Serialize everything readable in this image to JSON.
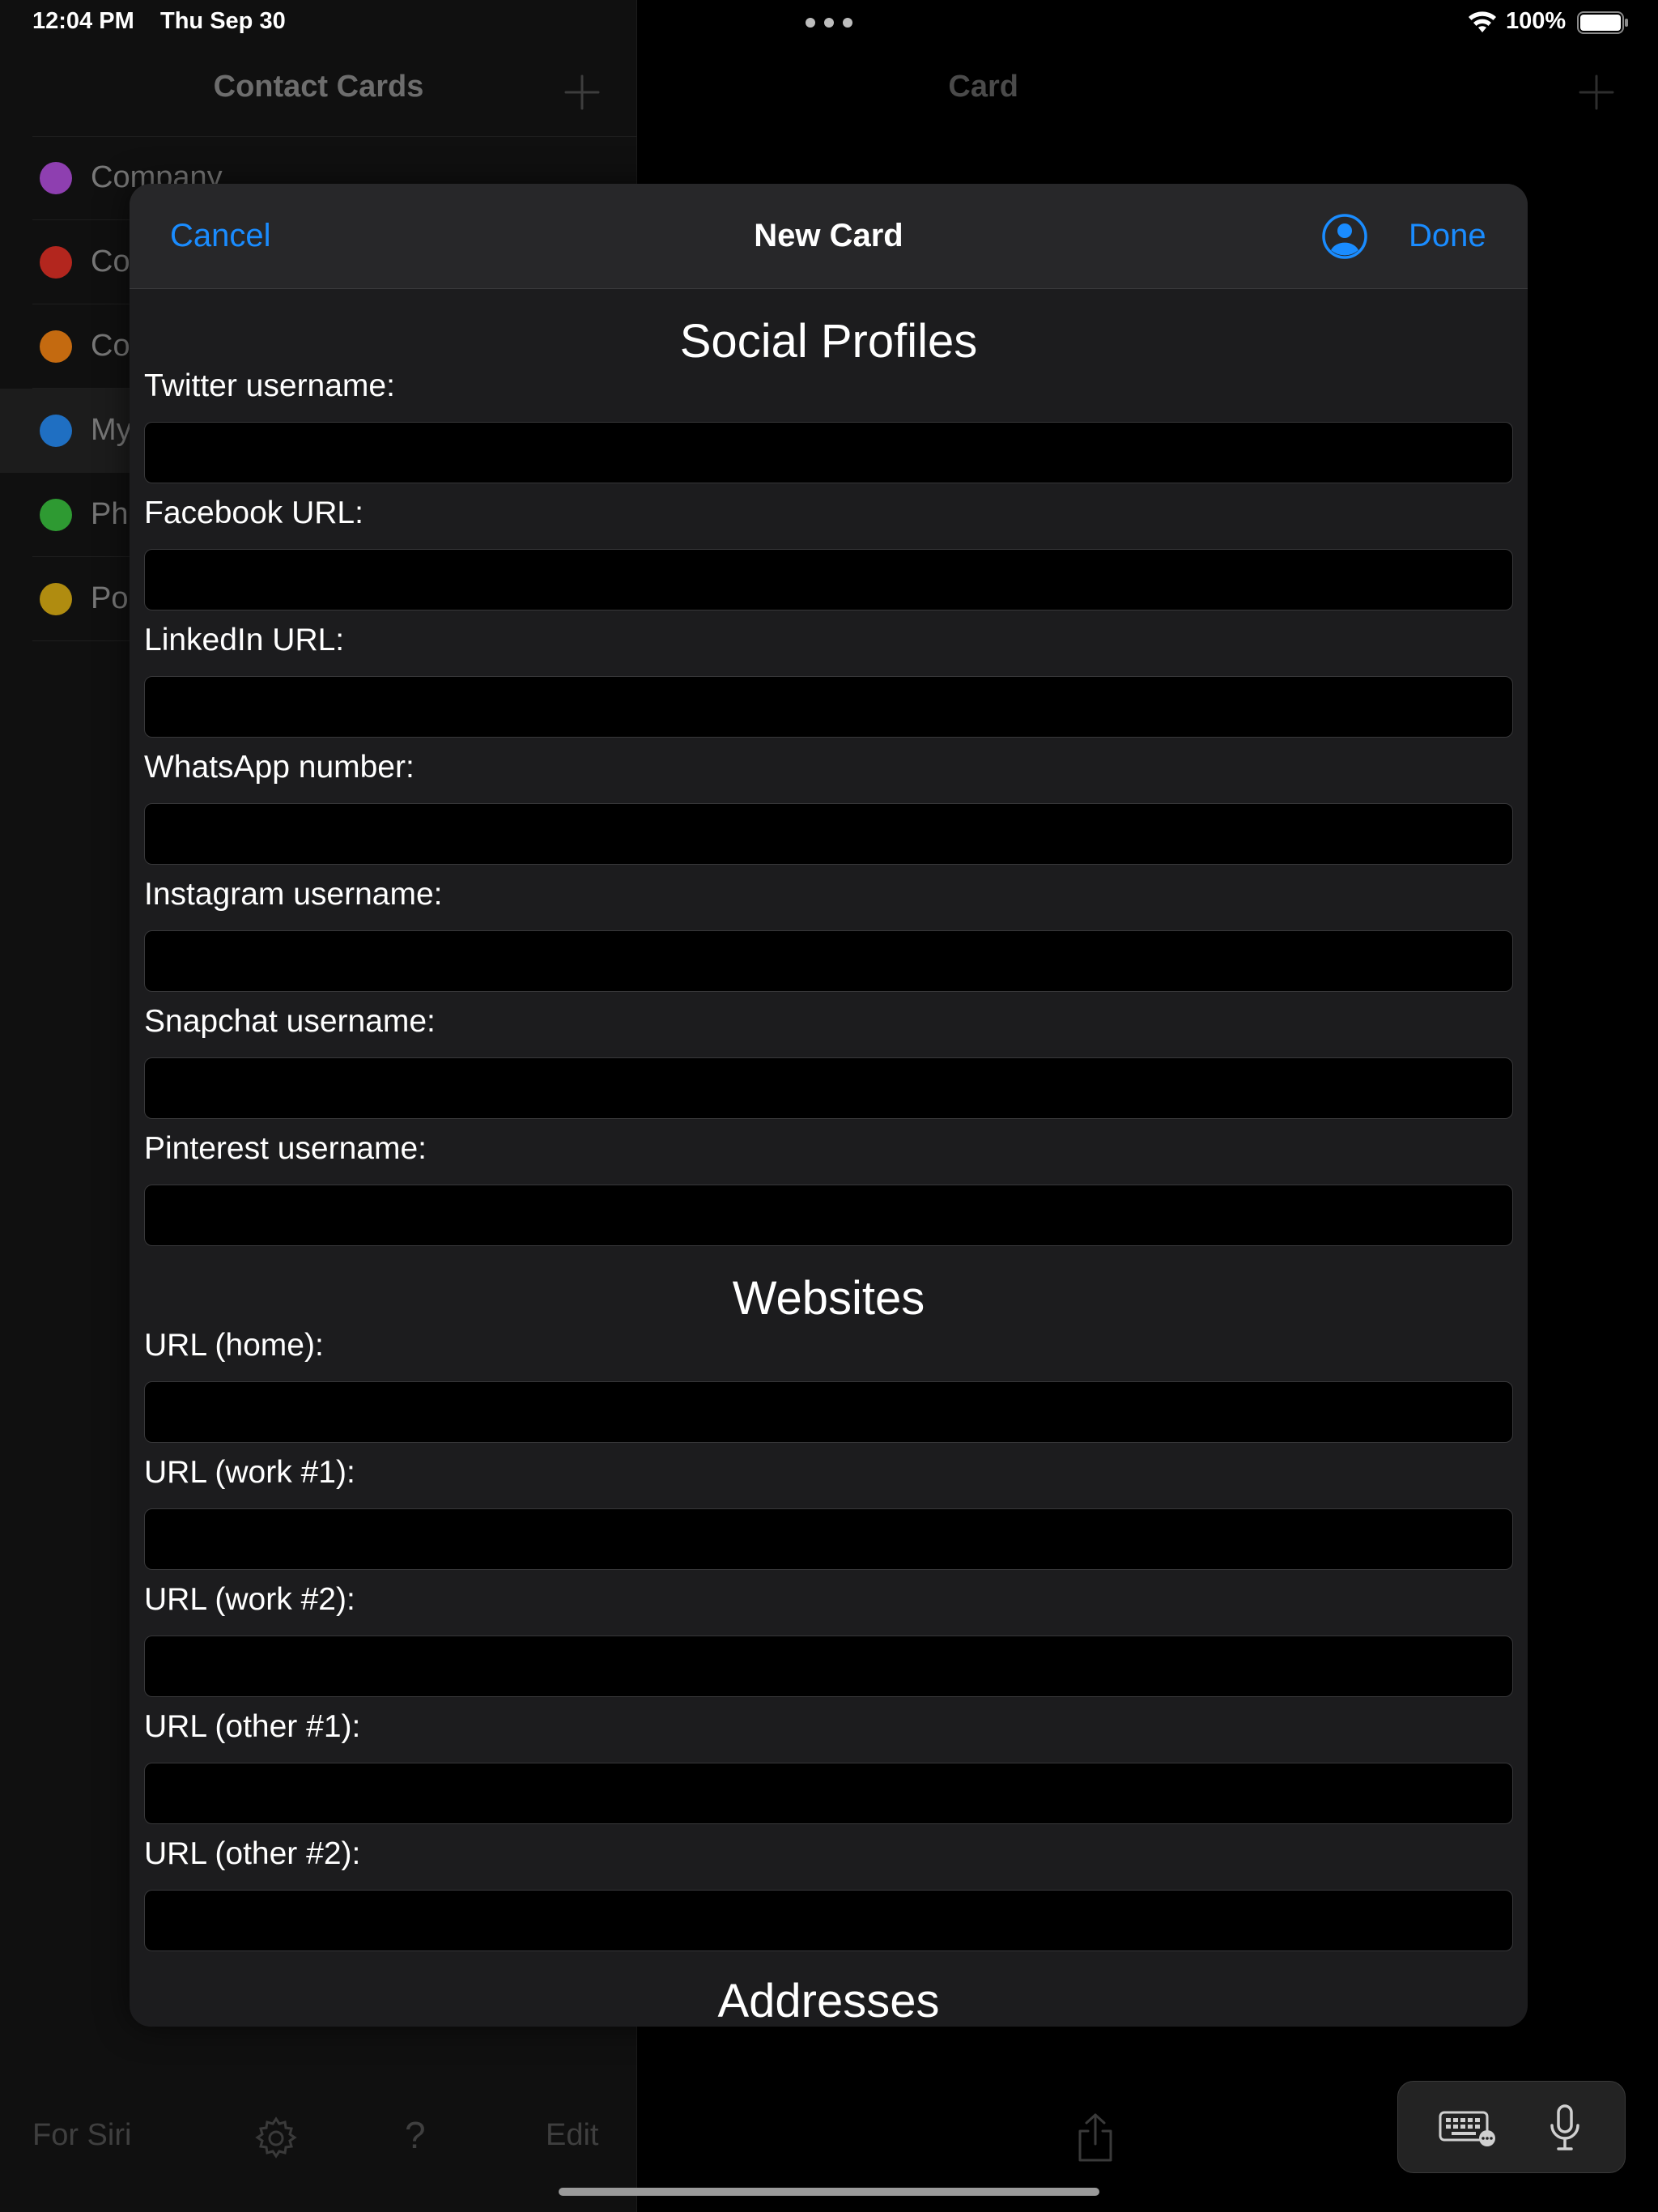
{
  "status_bar": {
    "time": "12:04 PM",
    "date": "Thu Sep 30",
    "battery_percent": "100%"
  },
  "sidebar": {
    "title": "Contact Cards",
    "items": [
      {
        "label": "Company",
        "color": "#8e3fb0"
      },
      {
        "label": "Co",
        "color": "#b3261e"
      },
      {
        "label": "Co",
        "color": "#c46a10"
      },
      {
        "label": "My",
        "color": "#1f6fc2",
        "selected": true
      },
      {
        "label": "Ph",
        "color": "#2e9a32"
      },
      {
        "label": "Po",
        "color": "#b08c10"
      }
    ],
    "toolbar": {
      "for_siri": "For Siri",
      "help": "?",
      "edit": "Edit"
    }
  },
  "detail": {
    "title": "Card"
  },
  "modal": {
    "cancel_label": "Cancel",
    "title": "New Card",
    "done_label": "Done",
    "accent_color": "#1a8cff",
    "sections": {
      "social": {
        "heading": "Social Profiles",
        "fields": [
          {
            "label": "Twitter username:",
            "value": ""
          },
          {
            "label": "Facebook URL:",
            "value": ""
          },
          {
            "label": "LinkedIn URL:",
            "value": ""
          },
          {
            "label": "WhatsApp number:",
            "value": ""
          },
          {
            "label": "Instagram username:",
            "value": ""
          },
          {
            "label": "Snapchat username:",
            "value": ""
          },
          {
            "label": "Pinterest username:",
            "value": ""
          }
        ]
      },
      "websites": {
        "heading": "Websites",
        "fields": [
          {
            "label": "URL (home):",
            "value": ""
          },
          {
            "label": "URL (work #1):",
            "value": ""
          },
          {
            "label": "URL (work #2):",
            "value": ""
          },
          {
            "label": "URL (other #1):",
            "value": ""
          },
          {
            "label": "URL (other #2):",
            "value": ""
          }
        ]
      },
      "addresses": {
        "heading": "Addresses"
      }
    }
  },
  "icons": {
    "wifi": "wifi-icon",
    "battery": "battery-icon",
    "plus": "plus-icon",
    "gear": "gear-icon",
    "share": "share-icon",
    "contact": "person-circle-icon",
    "keyboard": "keyboard-icon",
    "mic": "microphone-icon"
  }
}
